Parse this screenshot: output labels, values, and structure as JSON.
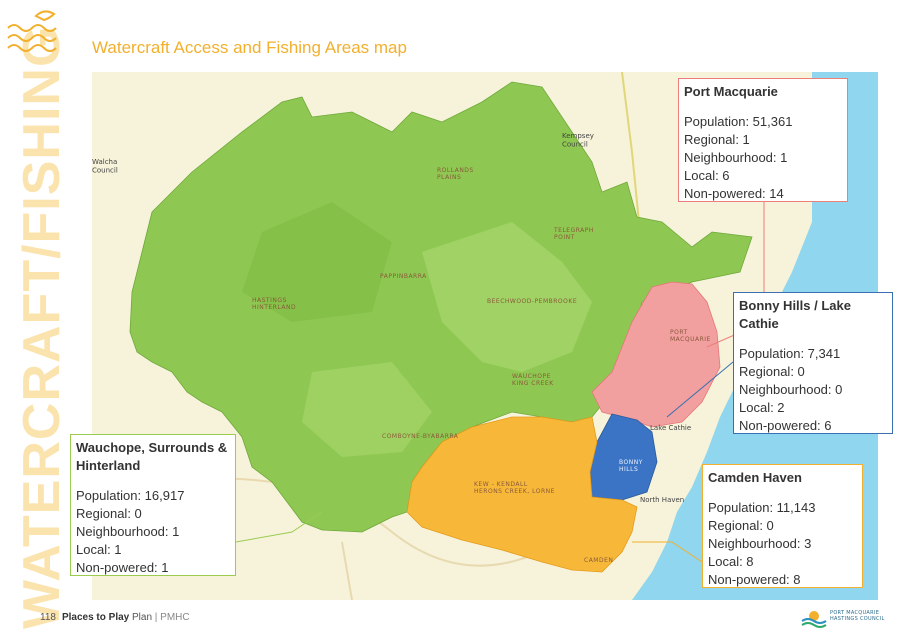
{
  "page": {
    "side_word": "WATERCRAFT/FISHING",
    "title": "Watercraft Access and Fishing Areas map"
  },
  "map": {
    "labels": {
      "kempsey": "Kempsey\nCouncil",
      "walcha": "Walcha\nCouncil",
      "rollands_plains": "ROLLANDS\nPLAINS",
      "telegraph_point": "TELEGRAPH\nPOINT",
      "pappinbarra": "PAPPINBARRA",
      "beechwood": "BEECHWOOD-PEMBROOKE",
      "hastings_hinterland": "HASTINGS\nHINTERLAND",
      "port_macquarie": "PORT\nMACQUARIE",
      "wauchope": "WAUCHOPE\nKING CREEK",
      "comboyne": "COMBOYNE-BYABARRA",
      "kew": "KEW - KENDALL\nHERONS CREEK, LORNE",
      "bonny_hills": "BONNY\nHILLS",
      "lake_cathie": "Lake Cathie",
      "north_haven": "North Haven",
      "camden": "CAMDEN"
    }
  },
  "areas": {
    "port_macquarie": {
      "name": "Port Macquarie",
      "population": "Population: 51,361",
      "regional": "Regional: 1",
      "neighbourhood": "Neighbourhood: 1",
      "local": "Local: 6",
      "non_powered": "Non-powered: 14"
    },
    "bonny_hills": {
      "name": "Bonny Hills / Lake Cathie",
      "population": "Population: 7,341",
      "regional": "Regional: 0",
      "neighbourhood": "Neighbourhood: 0",
      "local": "Local: 2",
      "non_powered": "Non-powered: 6"
    },
    "camden_haven": {
      "name": "Camden Haven",
      "population": "Population: 11,143",
      "regional": "Regional: 0",
      "neighbourhood": "Neighbourhood: 3",
      "local": "Local: 8",
      "non_powered": "Non-powered: 8"
    },
    "wauchope": {
      "name": "Wauchope, Surrounds & Hinterland",
      "population": "Population: 16,917",
      "regional": "Regional: 0",
      "neighbourhood": "Neighbourhood: 1",
      "local": "Local: 1",
      "non_powered": "Non-powered: 1"
    }
  },
  "footer": {
    "page_number": "118",
    "doc_bold": "Places to Play",
    "doc_plain": " Plan",
    "separator": " | ",
    "org": "PMHC",
    "logo_text_1": "PORT MACQUARIE",
    "logo_text_2": "HASTINGS COUNCIL"
  },
  "colors": {
    "accent": "#f2b02e",
    "port_macquarie": "#ee7d7d",
    "bonny_hills": "#3a6fb2",
    "camden_haven": "#f2b02e",
    "wauchope": "#9ccb52",
    "ocean": "#8fd6ee"
  }
}
